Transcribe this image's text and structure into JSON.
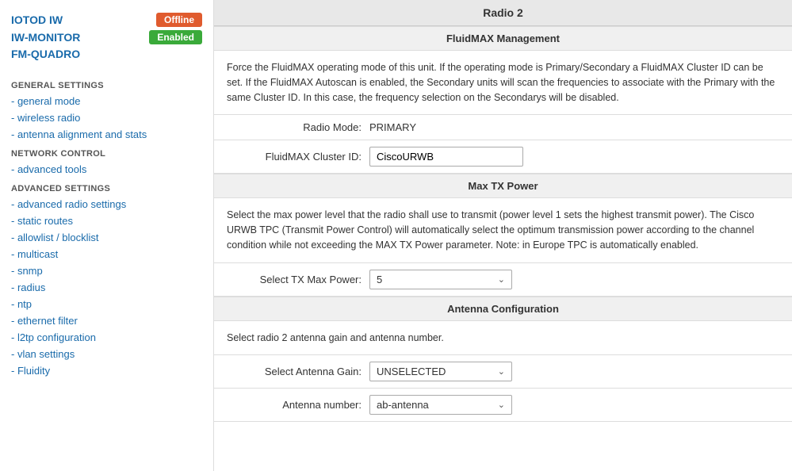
{
  "sidebar": {
    "top_links": [
      {
        "id": "iotod-iw",
        "label": "IOTOD IW",
        "badge": "Offline",
        "badge_type": "offline"
      },
      {
        "id": "iw-monitor",
        "label": "IW-MONITOR",
        "badge": "Enabled",
        "badge_type": "enabled"
      },
      {
        "id": "fm-quadro",
        "label": "FM-QUADRO",
        "badge": null,
        "badge_type": null
      }
    ],
    "sections": [
      {
        "id": "general-settings",
        "label": "GENERAL SETTINGS",
        "items": [
          {
            "id": "general-mode",
            "label": "- general mode"
          },
          {
            "id": "wireless-radio",
            "label": "- wireless radio"
          },
          {
            "id": "antenna-alignment",
            "label": "- antenna alignment and stats"
          }
        ]
      },
      {
        "id": "network-control",
        "label": "NETWORK CONTROL",
        "items": [
          {
            "id": "advanced-tools",
            "label": "- advanced tools"
          }
        ]
      },
      {
        "id": "advanced-settings",
        "label": "ADVANCED SETTINGS",
        "items": [
          {
            "id": "advanced-radio-settings",
            "label": "- advanced radio settings"
          },
          {
            "id": "static-routes",
            "label": "- static routes"
          },
          {
            "id": "allowlist-blocklist",
            "label": "- allowlist / blocklist"
          },
          {
            "id": "multicast",
            "label": "- multicast"
          },
          {
            "id": "snmp",
            "label": "- snmp"
          },
          {
            "id": "radius",
            "label": "- radius"
          },
          {
            "id": "ntp",
            "label": "- ntp"
          },
          {
            "id": "ethernet-filter",
            "label": "- ethernet filter"
          },
          {
            "id": "l2tp-configuration",
            "label": "- l2tp configuration"
          },
          {
            "id": "vlan-settings",
            "label": "- vlan settings"
          },
          {
            "id": "fluidity",
            "label": "- Fluidity"
          }
        ]
      }
    ]
  },
  "main": {
    "page_title": "Radio 2",
    "sections": [
      {
        "id": "fluidmax-management",
        "title": "FluidMAX Management",
        "description": "Force the FluidMAX operating mode of this unit. If the operating mode is Primary/Secondary a FluidMAX Cluster ID can be set. If the FluidMAX Autoscan is enabled, the Secondary units will scan the frequencies to associate with the Primary with the same Cluster ID. In this case, the frequency selection on the Secondarys will be disabled.",
        "fields": [
          {
            "id": "radio-mode",
            "label": "Radio Mode:",
            "type": "text",
            "value": "PRIMARY"
          },
          {
            "id": "fluidmax-cluster-id",
            "label": "FluidMAX Cluster ID:",
            "type": "input",
            "value": "CiscoURWB"
          }
        ]
      },
      {
        "id": "max-tx-power",
        "title": "Max TX Power",
        "description": "Select the max power level that the radio shall use to transmit (power level 1 sets the highest transmit power). The Cisco URWB TPC (Transmit Power Control) will automatically select the optimum transmission power according to the channel condition while not exceeding the MAX TX Power parameter. Note: in Europe TPC is automatically enabled.",
        "fields": [
          {
            "id": "select-tx-max-power",
            "label": "Select TX Max Power:",
            "type": "select",
            "value": "5"
          }
        ]
      },
      {
        "id": "antenna-configuration",
        "title": "Antenna Configuration",
        "description": "Select radio 2 antenna gain and antenna number.",
        "fields": [
          {
            "id": "select-antenna-gain",
            "label": "Select Antenna Gain:",
            "type": "select",
            "value": "UNSELECTED"
          },
          {
            "id": "antenna-number",
            "label": "Antenna number:",
            "type": "select",
            "value": "ab-antenna"
          }
        ]
      }
    ]
  }
}
